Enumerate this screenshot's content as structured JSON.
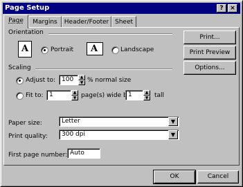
{
  "window": {
    "title": "Page Setup",
    "help_button": "?",
    "close_button": "×"
  },
  "tabs": [
    {
      "label": "Page",
      "active": true
    },
    {
      "label": "Margins"
    },
    {
      "label": "Header/Footer"
    },
    {
      "label": "Sheet"
    }
  ],
  "orientation": {
    "label": "Orientation",
    "portrait_label": "Portrait",
    "landscape_label": "Landscape",
    "selected": "Portrait",
    "icon_glyph": "A"
  },
  "scaling": {
    "label": "Scaling",
    "adjust_label": "Adjust to:",
    "adjust_value": "100",
    "adjust_suffix": "% normal size",
    "fit_label": "Fit to:",
    "fit_wide_value": "1",
    "fit_wide_suffix": "page(s) wide by",
    "fit_tall_value": "1",
    "fit_tall_suffix": "tall",
    "selected": "Adjust to:"
  },
  "paper_size": {
    "label": "Paper size:",
    "value": "Letter"
  },
  "print_quality": {
    "label": "Print quality:",
    "value": "300 dpi"
  },
  "first_page": {
    "label": "First page number:",
    "value": "Auto"
  },
  "side_buttons": {
    "print": "Print...",
    "print_preview": "Print Preview",
    "options": "Options..."
  },
  "footer_buttons": {
    "ok": "OK",
    "cancel": "Cancel"
  }
}
